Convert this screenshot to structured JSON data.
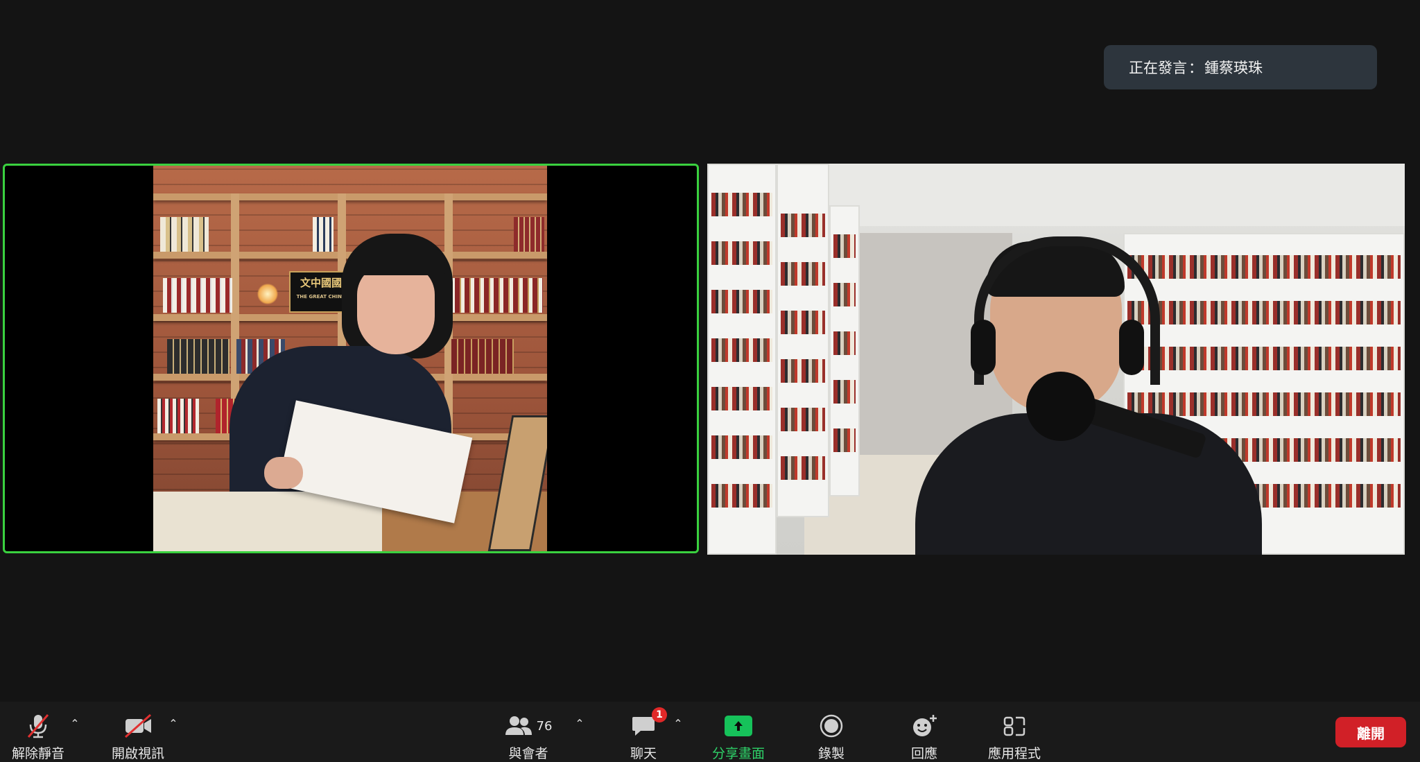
{
  "meeting": {
    "active_speaker_label": "正在發言",
    "active_speaker_separator": "：",
    "active_speaker_name": "鍾蔡瑛珠"
  },
  "videos": {
    "left_plaque_title": "文中國國",
    "left_plaque_subtitle": "THE GREAT CHINA"
  },
  "toolbar": {
    "unmute_label": "解除靜音",
    "start_video_label": "開啟視訊",
    "participants_label": "與會者",
    "participants_count": "76",
    "chat_label": "聊天",
    "chat_badge": "1",
    "share_label": "分享畫面",
    "record_label": "錄製",
    "reactions_label": "回應",
    "apps_label": "應用程式",
    "leave_label": "離開",
    "caret_glyph": "⌃"
  },
  "colors": {
    "active_border": "#3ad13f",
    "share_green": "#16c25a",
    "leave_red": "#d12027",
    "share_label": "#2ed168"
  }
}
